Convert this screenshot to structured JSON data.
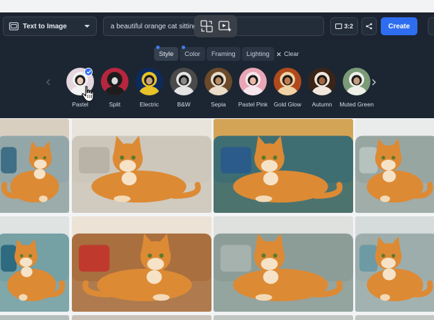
{
  "toolbar": {
    "mode_label": "Text to Image",
    "prompt_value": "a beautiful orange cat sitting o",
    "ratio_label": "3:2",
    "create_label": "Create"
  },
  "panel": {
    "tabs": [
      {
        "label": "Style",
        "active": true,
        "dot": true
      },
      {
        "label": "Color",
        "active": false,
        "dot": true
      },
      {
        "label": "Framing",
        "active": false,
        "dot": false
      },
      {
        "label": "Lighting",
        "active": false,
        "dot": false
      }
    ],
    "clear_label": "Clear",
    "styles": [
      {
        "label": "Pastel",
        "selected": true,
        "bg": "#e6d6e0",
        "suit": "#f2f2f2",
        "face": "#e9c9b8"
      },
      {
        "label": "Split",
        "selected": false,
        "bg": "#b6263f",
        "suit": "#1d1d1d",
        "face": "#dcdcdc"
      },
      {
        "label": "Electric",
        "selected": false,
        "bg": "#0d2a5c",
        "suit": "#e8c228",
        "face": "#c9a37a"
      },
      {
        "label": "B&W",
        "selected": false,
        "bg": "#4a4a4a",
        "suit": "#e4e4e4",
        "face": "#8a8a8a"
      },
      {
        "label": "Sepia",
        "selected": false,
        "bg": "#6b4a2a",
        "suit": "#e9dcc8",
        "face": "#b98a5e"
      },
      {
        "label": "Pastel Pink",
        "selected": false,
        "bg": "#e9a6b6",
        "suit": "#f7e6ec",
        "face": "#e8b8a6"
      },
      {
        "label": "Gold Glow",
        "selected": false,
        "bg": "#b04a1c",
        "suit": "#f0d2a4",
        "face": "#c27a4c"
      },
      {
        "label": "Autumn",
        "selected": false,
        "bg": "#3a2418",
        "suit": "#f1e7dc",
        "face": "#a2653f"
      },
      {
        "label": "Muted Green",
        "selected": false,
        "bg": "#7a9a78",
        "suit": "#eef0e8",
        "face": "#c59c7c"
      }
    ]
  },
  "colors": {
    "accent": "#2f6df0",
    "toolbar_bg": "#1b2430",
    "cat_orange": "#dd8a35"
  }
}
